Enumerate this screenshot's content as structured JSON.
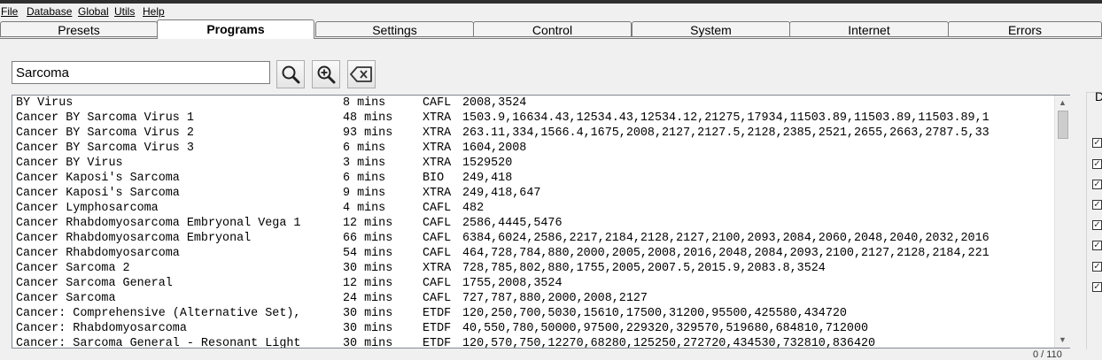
{
  "menu": [
    "File",
    "Database",
    "Global",
    "Utils",
    "Help"
  ],
  "tabs": [
    "Presets",
    "Programs",
    "Settings",
    "Control",
    "System",
    "Internet",
    "Errors"
  ],
  "active_tab": "Programs",
  "search": {
    "value": "Sarcoma"
  },
  "icons": {
    "search": "search-icon",
    "zoom": "zoom-in-icon",
    "clear": "clear-icon"
  },
  "programs": [
    {
      "name": "BY Virus",
      "time": "8 mins",
      "type": "CAFL",
      "freqs": "2008,3524"
    },
    {
      "name": "Cancer BY Sarcoma Virus 1",
      "time": "48 mins",
      "type": "XTRA",
      "freqs": "1503.9,16634.43,12534.43,12534.12,21275,17934,11503.89,11503.89,11503.89,1"
    },
    {
      "name": "Cancer BY Sarcoma Virus 2",
      "time": "93 mins",
      "type": "XTRA",
      "freqs": "263.11,334,1566.4,1675,2008,2127,2127.5,2128,2385,2521,2655,2663,2787.5,33"
    },
    {
      "name": "Cancer BY Sarcoma Virus 3",
      "time": "6 mins",
      "type": "XTRA",
      "freqs": "1604,2008"
    },
    {
      "name": "Cancer BY Virus",
      "time": "3 mins",
      "type": "XTRA",
      "freqs": "1529520"
    },
    {
      "name": "Cancer Kaposi's Sarcoma",
      "time": "6 mins",
      "type": "BIO",
      "freqs": "249,418"
    },
    {
      "name": "Cancer Kaposi's Sarcoma",
      "time": "9 mins",
      "type": "XTRA",
      "freqs": "249,418,647"
    },
    {
      "name": "Cancer Lymphosarcoma",
      "time": "4 mins",
      "type": "CAFL",
      "freqs": "482"
    },
    {
      "name": "Cancer Rhabdomyosarcoma Embryonal Vega 1",
      "time": "12 mins",
      "type": "CAFL",
      "freqs": "2586,4445,5476"
    },
    {
      "name": "Cancer Rhabdomyosarcoma Embryonal",
      "time": "66 mins",
      "type": "CAFL",
      "freqs": "6384,6024,2586,2217,2184,2128,2127,2100,2093,2084,2060,2048,2040,2032,2016"
    },
    {
      "name": "Cancer Rhabdomyosarcoma",
      "time": "54 mins",
      "type": "CAFL",
      "freqs": "464,728,784,880,2000,2005,2008,2016,2048,2084,2093,2100,2127,2128,2184,221"
    },
    {
      "name": "Cancer Sarcoma 2",
      "time": "30 mins",
      "type": "XTRA",
      "freqs": "728,785,802,880,1755,2005,2007.5,2015.9,2083.8,3524"
    },
    {
      "name": "Cancer Sarcoma General",
      "time": "12 mins",
      "type": "CAFL",
      "freqs": "1755,2008,3524"
    },
    {
      "name": "Cancer Sarcoma",
      "time": "24 mins",
      "type": "CAFL",
      "freqs": "727,787,880,2000,2008,2127"
    },
    {
      "name": "Cancer: Comprehensive (Alternative Set),",
      "time": "30 mins",
      "type": "ETDF",
      "freqs": "120,250,700,5030,15610,17500,31200,95500,425580,434720"
    },
    {
      "name": "Cancer: Rhabdomyosarcoma",
      "time": "30 mins",
      "type": "ETDF",
      "freqs": "40,550,780,50000,97500,229320,329570,519680,684810,712000"
    },
    {
      "name": "Cancer: Sarcoma General - Resonant Light",
      "time": "30 mins",
      "type": "ETDF",
      "freqs": "120,570,750,12270,68280,125250,272720,434530,732810,836420"
    }
  ],
  "right_panel_label": "D",
  "status_text": "0 / 110"
}
